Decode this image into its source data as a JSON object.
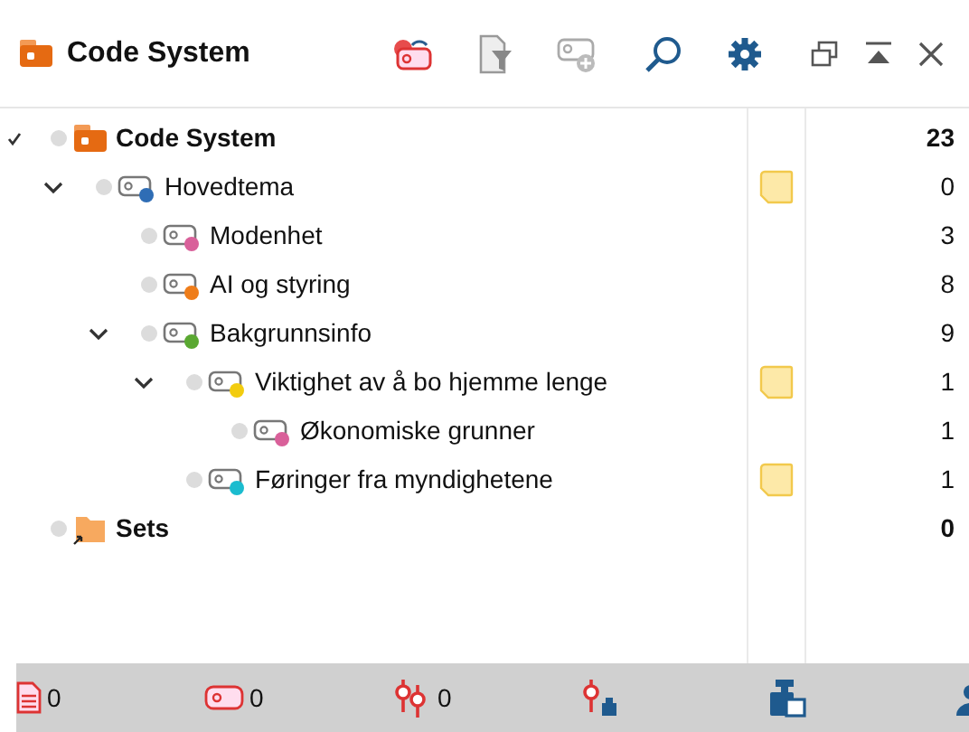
{
  "header": {
    "title": "Code System"
  },
  "tree": [
    {
      "kind": "root",
      "label": "Code System",
      "checked": true,
      "count": "23",
      "memo": false,
      "children": [
        {
          "kind": "code",
          "label": "Hovedtema",
          "color": "#2f6db5",
          "memo": true,
          "count": "0",
          "expanded": true,
          "children": [
            {
              "kind": "code",
              "label": "Modenhet",
              "color": "#d9609a",
              "memo": false,
              "count": "3"
            },
            {
              "kind": "code",
              "label": "AI og styring",
              "color": "#ef7d1a",
              "memo": false,
              "count": "8"
            },
            {
              "kind": "code",
              "label": "Bakgrunnsinfo",
              "color": "#5aa832",
              "memo": false,
              "count": "9",
              "expanded": true,
              "children": [
                {
                  "kind": "code",
                  "label": "Viktighet av å bo hjemme lenge",
                  "color": "#f2cc0f",
                  "memo": true,
                  "count": "1",
                  "expanded": true,
                  "children": [
                    {
                      "kind": "code",
                      "label": "Økonomiske grunner",
                      "color": "#d9609a",
                      "memo": false,
                      "count": "1"
                    }
                  ]
                },
                {
                  "kind": "code",
                  "label": "Føringer fra myndighetene",
                  "color": "#1bbccf",
                  "memo": true,
                  "count": "1"
                }
              ]
            }
          ]
        }
      ]
    },
    {
      "kind": "set",
      "label": "Sets",
      "checked": false,
      "count": "0",
      "memo": false
    }
  ],
  "status_bar": [
    {
      "kind": "documents",
      "count": "0"
    },
    {
      "kind": "codes",
      "count": "0"
    },
    {
      "kind": "segments",
      "count": "0"
    },
    {
      "kind": "weights"
    },
    {
      "kind": "variables"
    },
    {
      "kind": "person"
    }
  ]
}
